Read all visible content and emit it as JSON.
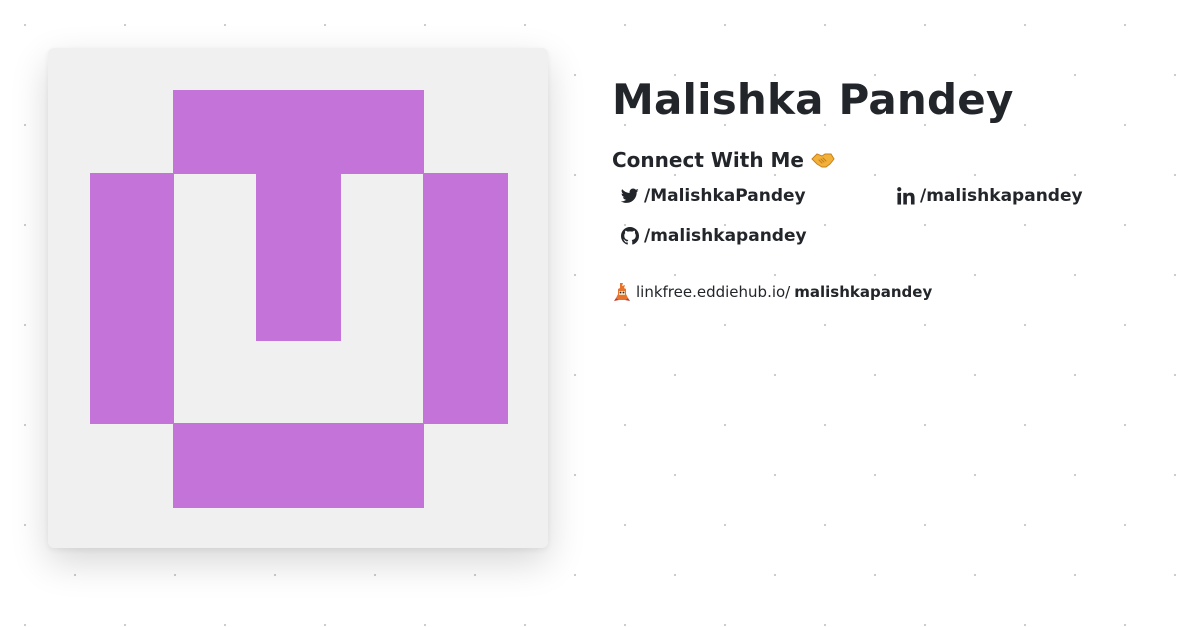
{
  "profile": {
    "name": "Malishka Pandey",
    "avatar_color": "#c474d8",
    "avatar_bg": "#f0f0f0"
  },
  "connect": {
    "heading": "Connect With Me",
    "emoji_icon": "handshake-icon"
  },
  "socials": [
    {
      "network": "twitter",
      "icon": "twitter-icon",
      "handle": "/MalishkaPandey"
    },
    {
      "network": "linkedin",
      "icon": "linkedin-icon",
      "handle": "/malishkapandey"
    },
    {
      "network": "github",
      "icon": "github-icon",
      "handle": "/malishkapandey"
    }
  ],
  "linkfree": {
    "icon": "linkfree-logo-icon",
    "domain": "linkfree.eddiehub.io/",
    "username": "malishkapandey"
  }
}
